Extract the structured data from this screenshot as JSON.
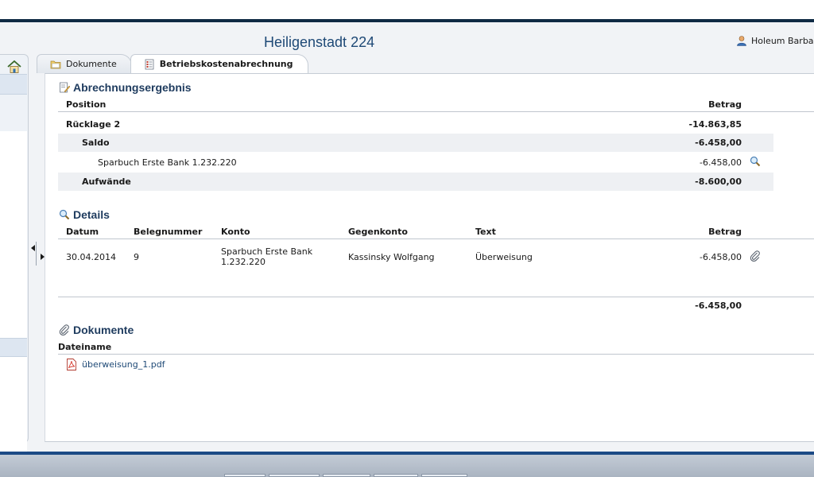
{
  "header": {
    "title": "Heiligenstadt 224",
    "user_name": "Holeum Barbara"
  },
  "tabs": [
    {
      "label": "Dokumente",
      "icon": "folder-icon",
      "active": false
    },
    {
      "label": "Betriebskostenabrechnung",
      "icon": "document-list-icon",
      "active": true
    }
  ],
  "abrechnung": {
    "title": "Abrechnungsergebnis",
    "col_position": "Position",
    "col_betrag": "Betrag",
    "rows": [
      {
        "label": "Rücklage 2",
        "amount": "-14.863,85"
      },
      {
        "label": "Saldo",
        "amount": "-6.458,00"
      },
      {
        "label": "Sparbuch Erste Bank 1.232.220",
        "amount": "-6.458,00"
      },
      {
        "label": "Aufwände",
        "amount": "-8.600,00"
      }
    ]
  },
  "details": {
    "title": "Details",
    "columns": {
      "datum": "Datum",
      "belegnummer": "Belegnummer",
      "konto": "Konto",
      "gegenkonto": "Gegenkonto",
      "text": "Text",
      "betrag": "Betrag"
    },
    "rows": [
      {
        "datum": "30.04.2014",
        "belegnummer": "9",
        "konto_line1": "Sparbuch Erste Bank",
        "konto_line2": "1.232.220",
        "gegenkonto": "Kassinsky Wolfgang",
        "text": "Überweisung",
        "betrag": "-6.458,00"
      }
    ],
    "total": "-6.458,00"
  },
  "dokumente": {
    "title": "Dokumente",
    "col_dateiname": "Dateiname",
    "files": [
      {
        "name": "überweisung_1.pdf",
        "icon": "pdf-icon"
      }
    ]
  },
  "colors": {
    "title_blue": "#1e4976",
    "header_rule": "#0f2a44",
    "bottom_rule": "#1c4a86",
    "row_band": "#eef0f3"
  }
}
